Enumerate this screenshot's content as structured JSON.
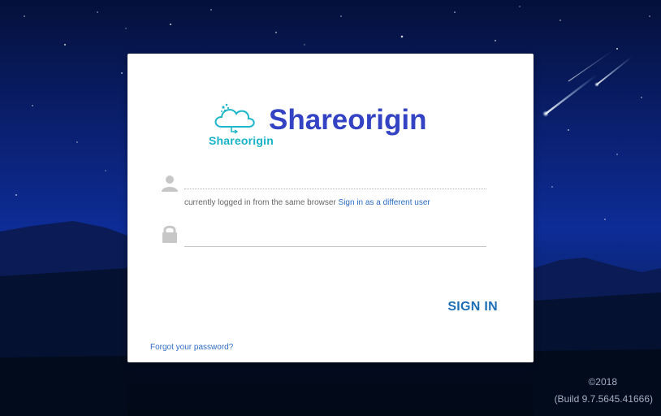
{
  "brand": {
    "logo_text": "Shareorigin",
    "name": "Shareorigin"
  },
  "form": {
    "username_value": "",
    "password_value": "",
    "hint_text": "currently logged in from the same browser",
    "hint_link": "Sign in as a different user",
    "sign_in_label": "SIGN IN",
    "forgot_label": "Forgot your password?"
  },
  "footer": {
    "copyright": "©2018",
    "build": "(Build 9.7.5645.41666)"
  },
  "icons": {
    "username": "user-icon",
    "password": "lock-icon"
  },
  "colors": {
    "brand": "#3343c4",
    "logo_accent": "#18b3c8",
    "link": "#2c6cc4",
    "sign_in": "#1e6fb5"
  }
}
